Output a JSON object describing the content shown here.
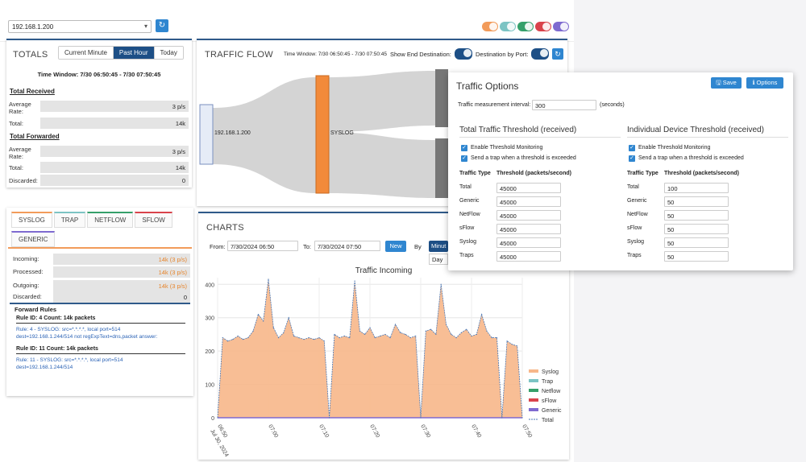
{
  "topbar": {
    "ip_selected": "192.168.1.200"
  },
  "colors": {
    "syslog": "#f7b78a",
    "trap": "#7cc4c4",
    "netflow": "#35a06a",
    "sflow": "#d9434b",
    "generic": "#7e6ad0",
    "accent": "#2f86d0",
    "header": "#1d4f86"
  },
  "totals": {
    "title": "TOTALS",
    "ranges": [
      "Current Minute",
      "Past Hour",
      "Today"
    ],
    "active_range": "Past Hour",
    "time_window": "Time Window: 7/30 06:50:45 - 7/30 07:50:45",
    "received": {
      "heading": "Total Received",
      "avg_label": "Average Rate:",
      "avg_value": "3 p/s",
      "total_label": "Total:",
      "total_value": "14k"
    },
    "forwarded": {
      "heading": "Total Forwarded",
      "avg_label": "Average Rate:",
      "avg_value": "3 p/s",
      "total_label": "Total:",
      "total_value": "14k",
      "discarded_label": "Discarded:",
      "discarded_value": "0"
    }
  },
  "protocols": {
    "tabs": [
      "SYSLOG",
      "TRAP",
      "NETFLOW",
      "SFLOW",
      "GENERIC"
    ],
    "incoming_label": "Incoming:",
    "incoming_value": "14k (3 p/s)",
    "processed_label": "Processed:",
    "processed_value": "14k (3 p/s)",
    "outgoing_label": "Outgoing:",
    "outgoing_value": "14k (3 p/s)",
    "discarded_label": "Discarded:",
    "discarded_value": "0",
    "rules_heading": "Forward Rules",
    "rules": [
      {
        "title": "Rule ID: 4 Count: 14k packets",
        "line1": "Rule: 4 - SYSLOG: src=*.*.*.*, local port=514",
        "line2": "dest=192.168.1.244/514 not regExpText=dns,packet answer:"
      },
      {
        "title": "Rule ID: 11 Count: 14k packets",
        "line1": "Rule: 11 - SYSLOG: src=*.*.*.*, local port=514",
        "line2": "dest=192.168.1.244/514"
      }
    ]
  },
  "traffic_flow": {
    "title": "TRAFFIC FLOW",
    "time_window": "Time Window: 7/30 06:50:45 - 7/30 07:50:45",
    "show_end_label": "Show End Destination:",
    "dest_by_port_label": "Destination by Port:",
    "source_node": "192.168.1.200",
    "mid_node": "SYSLOG"
  },
  "charts": {
    "title": "CHARTS",
    "from_label": "From:",
    "from_value": "7/30/2024 06:50",
    "to_label": "To:",
    "to_value": "7/30/2024 07:50",
    "new_label": "New",
    "by_label": "By",
    "by_value": "Minut",
    "dropdown_option": "Day"
  },
  "chart_data": {
    "type": "area",
    "title": "Traffic Incoming",
    "ylim": [
      0,
      420
    ],
    "yticks": [
      0,
      100,
      200,
      300,
      400
    ],
    "x": [
      "06:50",
      "06:51",
      "06:52",
      "06:53",
      "06:54",
      "06:55",
      "06:56",
      "06:57",
      "06:58",
      "06:59",
      "07:00",
      "07:01",
      "07:02",
      "07:03",
      "07:04",
      "07:05",
      "07:06",
      "07:07",
      "07:08",
      "07:09",
      "07:10",
      "07:11",
      "07:12",
      "07:13",
      "07:14",
      "07:15",
      "07:16",
      "07:17",
      "07:18",
      "07:19",
      "07:20",
      "07:21",
      "07:22",
      "07:23",
      "07:24",
      "07:25",
      "07:26",
      "07:27",
      "07:28",
      "07:29",
      "07:30",
      "07:31",
      "07:32",
      "07:33",
      "07:34",
      "07:35",
      "07:36",
      "07:37",
      "07:38",
      "07:39",
      "07:40",
      "07:41",
      "07:42",
      "07:43",
      "07:44",
      "07:45",
      "07:46",
      "07:47",
      "07:48",
      "07:49",
      "07:50"
    ],
    "xtick_labels": [
      "06:50\nJul 30, 2024",
      "07:00",
      "07:10",
      "07:20",
      "07:30",
      "07:40",
      "07:50"
    ],
    "series": [
      {
        "name": "Syslog",
        "values": [
          0,
          240,
          230,
          235,
          245,
          235,
          240,
          260,
          310,
          290,
          415,
          270,
          240,
          255,
          300,
          245,
          240,
          235,
          240,
          235,
          240,
          230,
          0,
          250,
          240,
          245,
          240,
          410,
          260,
          250,
          270,
          240,
          245,
          250,
          240,
          280,
          255,
          250,
          240,
          245,
          0,
          260,
          265,
          250,
          400,
          280,
          250,
          240,
          255,
          265,
          245,
          250,
          310,
          260,
          240,
          240,
          0,
          230,
          220,
          215,
          0
        ]
      },
      {
        "name": "Trap",
        "values": [
          0,
          0,
          0,
          0,
          0,
          0,
          0,
          0,
          0,
          0,
          0,
          0,
          0,
          0,
          0,
          0,
          0,
          0,
          0,
          0,
          0,
          0,
          0,
          0,
          0,
          0,
          0,
          0,
          0,
          0,
          0,
          0,
          0,
          0,
          0,
          0,
          0,
          0,
          0,
          0,
          0,
          0,
          0,
          0,
          0,
          0,
          0,
          0,
          0,
          0,
          0,
          0,
          0,
          0,
          0,
          0,
          0,
          0,
          0,
          0,
          0
        ]
      },
      {
        "name": "Netflow",
        "values": [
          0,
          0,
          0,
          0,
          0,
          0,
          0,
          0,
          0,
          0,
          0,
          0,
          0,
          0,
          0,
          0,
          0,
          0,
          0,
          0,
          0,
          0,
          0,
          0,
          0,
          0,
          0,
          0,
          0,
          0,
          0,
          0,
          0,
          0,
          0,
          0,
          0,
          0,
          0,
          0,
          0,
          0,
          0,
          0,
          0,
          0,
          0,
          0,
          0,
          0,
          0,
          0,
          0,
          0,
          0,
          0,
          0,
          0,
          0,
          0,
          0
        ]
      },
      {
        "name": "sFlow",
        "values": [
          0,
          0,
          0,
          0,
          0,
          0,
          0,
          0,
          0,
          0,
          0,
          0,
          0,
          0,
          0,
          0,
          0,
          0,
          0,
          0,
          0,
          0,
          0,
          0,
          0,
          0,
          0,
          0,
          0,
          0,
          0,
          0,
          0,
          0,
          0,
          0,
          0,
          0,
          0,
          0,
          0,
          0,
          0,
          0,
          0,
          0,
          0,
          0,
          0,
          0,
          0,
          0,
          0,
          0,
          0,
          0,
          0,
          0,
          0,
          0,
          0
        ]
      },
      {
        "name": "Generic",
        "values": [
          0,
          0,
          0,
          0,
          0,
          0,
          0,
          0,
          0,
          0,
          0,
          0,
          0,
          0,
          0,
          0,
          0,
          0,
          0,
          0,
          0,
          0,
          0,
          0,
          0,
          0,
          0,
          0,
          0,
          0,
          0,
          0,
          0,
          0,
          0,
          0,
          0,
          0,
          0,
          0,
          0,
          0,
          0,
          0,
          0,
          0,
          0,
          0,
          0,
          0,
          0,
          0,
          0,
          0,
          0,
          0,
          0,
          0,
          0,
          0,
          0
        ]
      },
      {
        "name": "Total",
        "values": [
          0,
          240,
          230,
          235,
          245,
          235,
          240,
          260,
          310,
          290,
          415,
          270,
          240,
          255,
          300,
          245,
          240,
          235,
          240,
          235,
          240,
          230,
          0,
          250,
          240,
          245,
          240,
          410,
          260,
          250,
          270,
          240,
          245,
          250,
          240,
          280,
          255,
          250,
          240,
          245,
          0,
          260,
          265,
          250,
          400,
          280,
          250,
          240,
          255,
          265,
          245,
          250,
          310,
          260,
          240,
          240,
          0,
          230,
          220,
          215,
          0
        ]
      }
    ],
    "legend_position": "right"
  },
  "modal": {
    "title": "Traffic Options",
    "save_label": "Save",
    "options_label": "Options",
    "interval_label": "Traffic measurement interval:",
    "interval_value": "300",
    "interval_unit": "(seconds)",
    "total_heading": "Total Traffic Threshold (received)",
    "device_heading": "Individual Device Threshold (received)",
    "enable_label": "Enable Threshold Monitoring",
    "trap_label": "Send a trap when a threshold is exceeded",
    "col_type": "Traffic Type",
    "col_threshold": "Threshold (packets/second)",
    "types": [
      "Total",
      "Generic",
      "NetFlow",
      "sFlow",
      "Syslog",
      "Traps"
    ],
    "total_values": [
      "45000",
      "45000",
      "45000",
      "45000",
      "45000",
      "45000"
    ],
    "device_values": [
      "100",
      "50",
      "50",
      "50",
      "50",
      "50"
    ]
  }
}
